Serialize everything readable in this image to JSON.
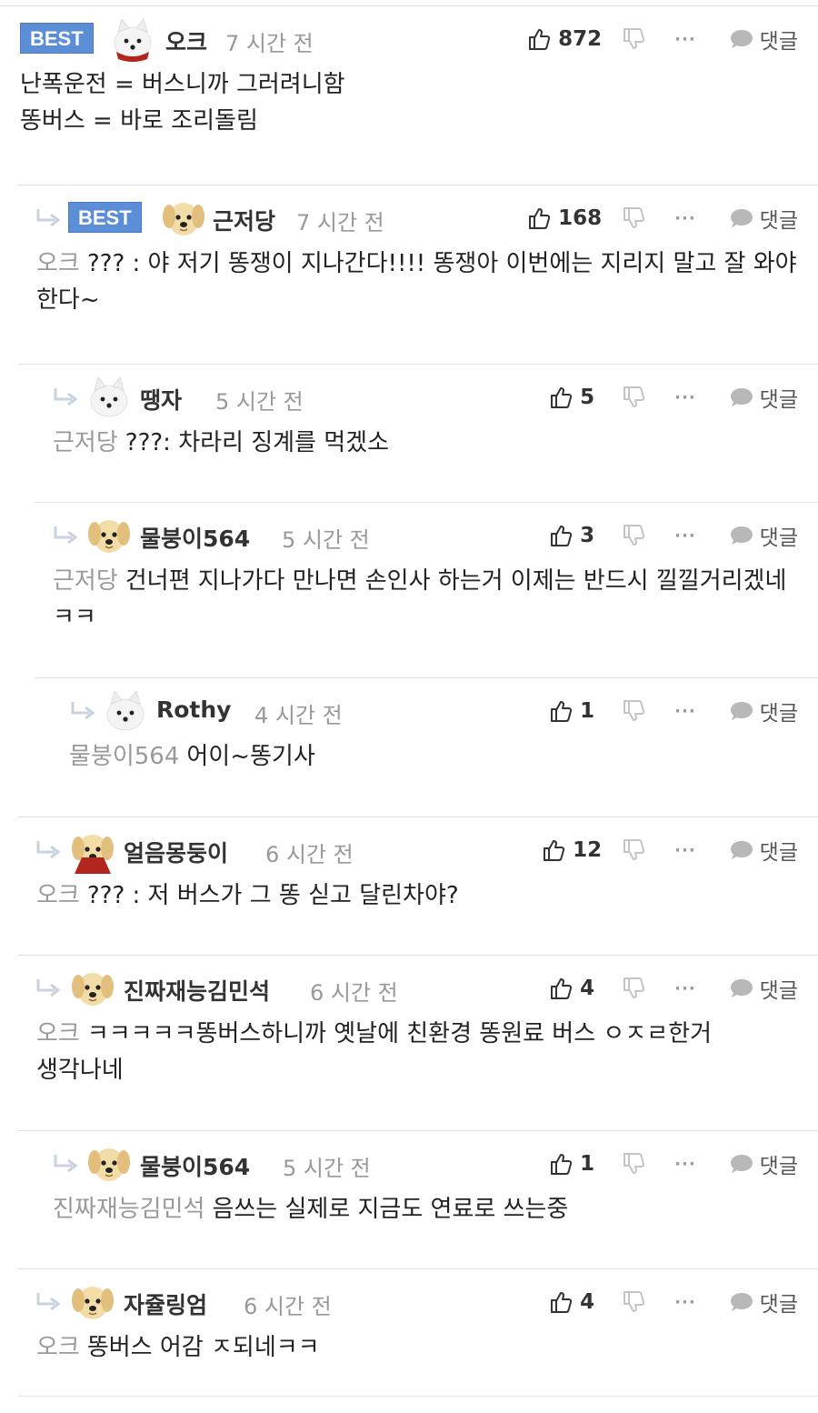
{
  "ui": {
    "badge_label": "BEST",
    "reply_label": "댓글",
    "more_label": "···"
  },
  "colors": {
    "badge": "#5b8ed6",
    "muted": "#999999",
    "divider": "#e0e0e0"
  },
  "icons": {
    "like": "thumbs-up-icon",
    "dislike": "thumbs-down-icon",
    "more": "ellipsis-icon",
    "reply": "speech-bubble-icon",
    "indent": "reply-arrow-icon"
  },
  "comments": [
    {
      "author": "오크",
      "time": "7 시간 전",
      "likes": "872",
      "best": true,
      "mention": "",
      "text": "난폭운전 = 버스니까 그러려니함\n똥버스 = 바로 조리돌림",
      "avatar": "samoyed-with-red-scarf"
    },
    {
      "author": "근저당",
      "time": "7 시간 전",
      "likes": "168",
      "best": true,
      "mention": "오크",
      "text": "??? : 야 저기 똥쟁이 지나간다!!!! 똥쟁아 이번에는 지리지 말고 잘 와야 한다~",
      "avatar": "labrador-puppy"
    },
    {
      "author": "땡자",
      "time": "5 시간 전",
      "likes": "5",
      "best": false,
      "mention": "근저당",
      "text": "???: 차라리 징계를 먹겠소",
      "avatar": "samoyed"
    },
    {
      "author": "물붕이564",
      "time": "5 시간 전",
      "likes": "3",
      "best": false,
      "mention": "근저당",
      "text": "건너편 지나가다 만나면 손인사 하는거 이제는 반드시 낄낄거리겠네 ㅋㅋ",
      "avatar": "labrador-puppy"
    },
    {
      "author": "Rothy",
      "time": "4 시간 전",
      "likes": "1",
      "best": false,
      "mention": "물붕이564",
      "text": "어이~똥기사",
      "avatar": "samoyed"
    },
    {
      "author": "얼음몽둥이",
      "time": "6 시간 전",
      "likes": "12",
      "best": false,
      "mention": "오크",
      "text": "??? : 저 버스가 그 똥 싣고 달린차야?",
      "avatar": "labrador-with-red-cape"
    },
    {
      "author": "진짜재능김민석",
      "time": "6 시간 전",
      "likes": "4",
      "best": false,
      "mention": "오크",
      "text": "ㅋㅋㅋㅋㅋ똥버스하니까 옛날에 친환경 똥원료 버스 ㅇㅈㄹ한거 생각나네",
      "avatar": "labrador-puppy"
    },
    {
      "author": "물붕이564",
      "time": "5 시간 전",
      "likes": "1",
      "best": false,
      "mention": "진짜재능김민석",
      "text": "음쓰는 실제로 지금도 연료로 쓰는중",
      "avatar": "labrador-puppy"
    },
    {
      "author": "자쥴링엄",
      "time": "6 시간 전",
      "likes": "4",
      "best": false,
      "mention": "오크",
      "text": "똥버스 어감 ㅈ되네ㅋㅋ",
      "avatar": "labrador-puppy"
    }
  ]
}
